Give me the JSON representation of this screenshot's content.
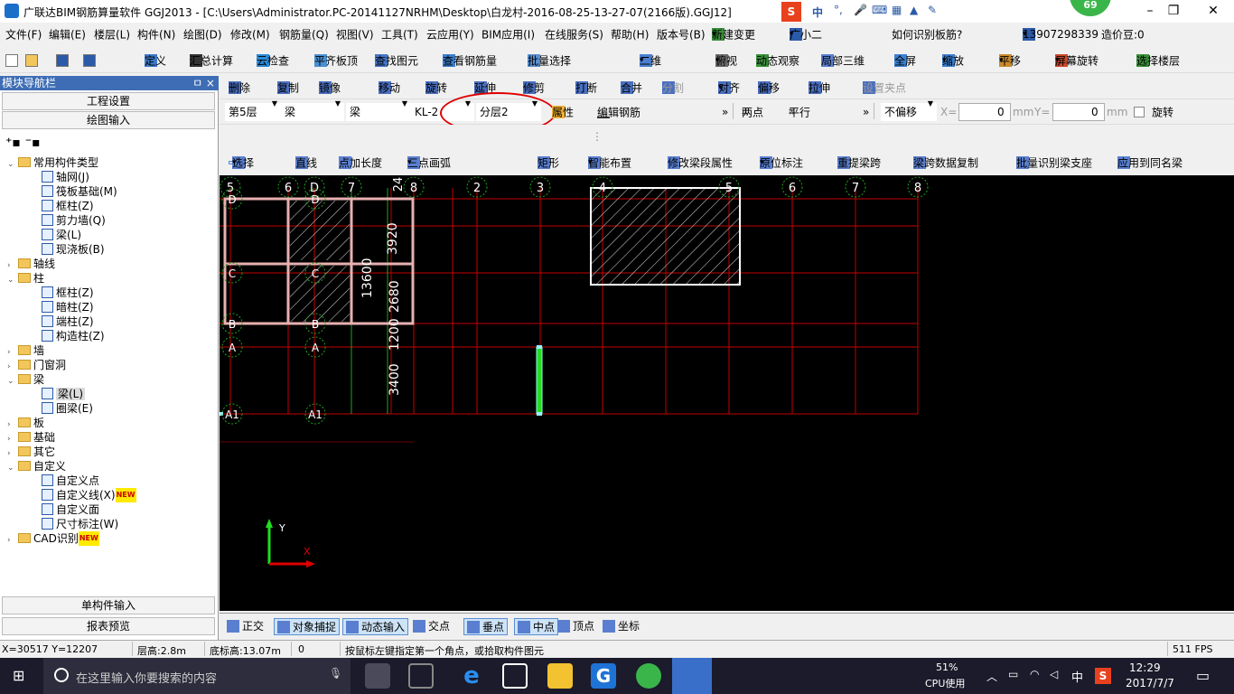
{
  "window": {
    "title": "广联达BIM钢筋算量软件 GGJ2013 - [C:\\Users\\Administrator.PC-20141127NRHM\\Desktop\\白龙村-2016-08-25-13-27-07(2166版).GGJ12]",
    "badge": "69",
    "ime": "中"
  },
  "menu": [
    "文件(F)",
    "编辑(E)",
    "楼层(L)",
    "构件(N)",
    "绘图(D)",
    "修改(M)",
    "钢筋量(Q)",
    "视图(V)",
    "工具(T)",
    "云应用(Y)",
    "BIM应用(I)",
    "在线服务(S)",
    "帮助(H)",
    "版本号(B)",
    "新建变更",
    "广小二",
    "如何识别板筋?",
    "13907298339",
    "造价豆:0"
  ],
  "toolbar1": [
    "定义",
    "汇总计算",
    "云检查",
    "平齐板顶",
    "查找图元",
    "查看钢筋量",
    "批量选择",
    "二维",
    "俯视",
    "动态观察",
    "局部三维",
    "全屏",
    "缩放",
    "平移",
    "屏幕旋转",
    "选择楼层"
  ],
  "toolbar2": [
    "删除",
    "复制",
    "镜像",
    "移动",
    "旋转",
    "延伸",
    "修剪",
    "打断",
    "合并",
    "分割",
    "对齐",
    "偏移",
    "拉伸",
    "设置夹点"
  ],
  "toolbar3": {
    "floor": "第5层",
    "cat": "梁",
    "type": "梁",
    "name": "KL-2",
    "layer": "分层2",
    "prop": "属性",
    "edit": "编辑钢筋",
    "twopt": "两点",
    "parallel": "平行",
    "offset": "不偏移",
    "x_label": "X=",
    "x_val": "0",
    "y_label": "Y=",
    "y_val": "0",
    "unit": "mm",
    "rotate": "旋转"
  },
  "toolbar4": [
    "选择",
    "直线",
    "点加长度",
    "三点画弧",
    "矩形",
    "智能布置",
    "修改梁段属性",
    "原位标注",
    "重提梁跨",
    "梁跨数据复制",
    "批量识别梁支座",
    "应用到同名梁"
  ],
  "leftpanel": {
    "title": "模块导航栏",
    "pin": "ㅁ ×",
    "btn_project": "工程设置",
    "btn_draw": "绘图输入",
    "btn_single": "单构件输入",
    "btn_report": "报表预览",
    "tree": [
      {
        "label": "常用构件类型",
        "lvl": 0,
        "folder": true,
        "open": true
      },
      {
        "label": "轴网(J)",
        "lvl": 2
      },
      {
        "label": "筏板基础(M)",
        "lvl": 2
      },
      {
        "label": "框柱(Z)",
        "lvl": 2
      },
      {
        "label": "剪力墙(Q)",
        "lvl": 2
      },
      {
        "label": "梁(L)",
        "lvl": 2
      },
      {
        "label": "现浇板(B)",
        "lvl": 2
      },
      {
        "label": "轴线",
        "lvl": 0,
        "folder": true
      },
      {
        "label": "柱",
        "lvl": 0,
        "folder": true,
        "open": true
      },
      {
        "label": "框柱(Z)",
        "lvl": 2
      },
      {
        "label": "暗柱(Z)",
        "lvl": 2
      },
      {
        "label": "端柱(Z)",
        "lvl": 2
      },
      {
        "label": "构造柱(Z)",
        "lvl": 2
      },
      {
        "label": "墙",
        "lvl": 0,
        "folder": true
      },
      {
        "label": "门窗洞",
        "lvl": 0,
        "folder": true
      },
      {
        "label": "梁",
        "lvl": 0,
        "folder": true,
        "open": true
      },
      {
        "label": "梁(L)",
        "lvl": 2,
        "sel": true
      },
      {
        "label": "圈梁(E)",
        "lvl": 2
      },
      {
        "label": "板",
        "lvl": 0,
        "folder": true
      },
      {
        "label": "基础",
        "lvl": 0,
        "folder": true
      },
      {
        "label": "其它",
        "lvl": 0,
        "folder": true
      },
      {
        "label": "自定义",
        "lvl": 0,
        "folder": true,
        "open": true
      },
      {
        "label": "自定义点",
        "lvl": 2
      },
      {
        "label": "自定义线(X)",
        "lvl": 2,
        "new": true
      },
      {
        "label": "自定义面",
        "lvl": 2
      },
      {
        "label": "尺寸标注(W)",
        "lvl": 2
      },
      {
        "label": "CAD识别",
        "lvl": 0,
        "folder": true,
        "new": true
      }
    ],
    "new_label": "NEW"
  },
  "canvas": {
    "top_axes": [
      "5",
      "6",
      "D",
      "7",
      "24",
      "8",
      "2",
      "3",
      "4",
      "5",
      "6",
      "7",
      "8"
    ],
    "left_axes": [
      "D",
      "C",
      "C",
      "B",
      "B",
      "A",
      "A",
      "A1",
      "A1"
    ],
    "dims": [
      "3920",
      "13600",
      "2680",
      "1200",
      "3400"
    ],
    "ucs": {
      "x": "X",
      "y": "Y"
    }
  },
  "snapbar": [
    "正交",
    "对象捕捉",
    "动态输入",
    "交点",
    "垂点",
    "中点",
    "顶点",
    "坐标"
  ],
  "status": {
    "coords": "X=30517 Y=12207",
    "floor_h": "层高:2.8m",
    "base_h": "底标高:13.07m",
    "zero": "0",
    "hint": "按鼠标左键指定第一个角点，或拾取构件图元",
    "fps": "511 FPS"
  },
  "taskbar": {
    "search": "在这里输入你要搜索的内容",
    "cpu": "51%",
    "cpu_label": "CPU使用",
    "ime": "中",
    "time": "12:29",
    "date": "2017/7/7"
  },
  "colors": {
    "accent": "#3e6db5",
    "grid": "#c40000",
    "annot": "#e00000"
  }
}
